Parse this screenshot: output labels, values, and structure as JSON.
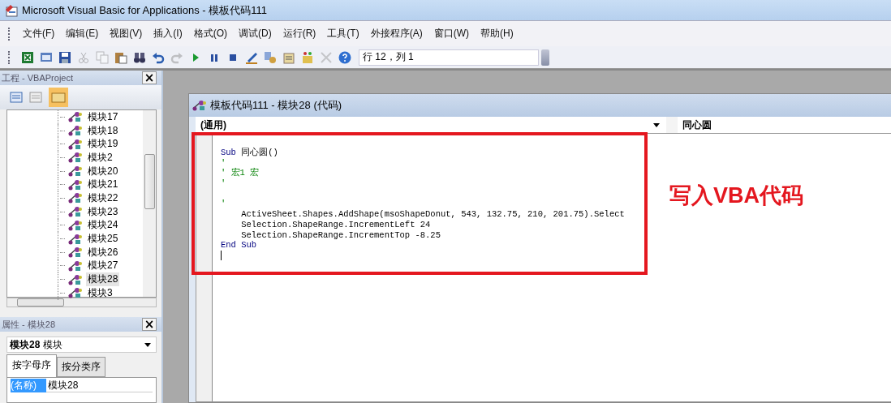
{
  "window": {
    "title": "Microsoft Visual Basic for Applications - 模板代码111"
  },
  "menu": [
    "文件(F)",
    "编辑(E)",
    "视图(V)",
    "插入(I)",
    "格式(O)",
    "调试(D)",
    "运行(R)",
    "工具(T)",
    "外接程序(A)",
    "窗口(W)",
    "帮助(H)"
  ],
  "toolbar": {
    "buttons": [
      {
        "kind": "excel",
        "disabled": false
      },
      {
        "kind": "form",
        "disabled": false
      },
      {
        "kind": "save",
        "disabled": false
      },
      {
        "kind": "cut",
        "disabled": true
      },
      {
        "kind": "copy",
        "disabled": true
      },
      {
        "kind": "paste",
        "disabled": false
      },
      {
        "kind": "find",
        "disabled": false
      },
      {
        "kind": "undo",
        "disabled": false
      },
      {
        "kind": "redo",
        "disabled": true
      },
      {
        "kind": "run",
        "disabled": false
      },
      {
        "kind": "pause",
        "disabled": false
      },
      {
        "kind": "stop",
        "disabled": false
      },
      {
        "kind": "design",
        "disabled": false
      },
      {
        "kind": "explorer",
        "disabled": false
      },
      {
        "kind": "properties",
        "disabled": false
      },
      {
        "kind": "browser",
        "disabled": false
      },
      {
        "kind": "toolbox",
        "disabled": true
      },
      {
        "kind": "help",
        "disabled": false
      }
    ],
    "position": "行 12，列 1"
  },
  "project_pane": {
    "title": "工程 - VBAProject",
    "close": "×",
    "items": [
      {
        "name": "模块17",
        "selected": false
      },
      {
        "name": "模块18",
        "selected": false
      },
      {
        "name": "模块19",
        "selected": false
      },
      {
        "name": "模块2",
        "selected": false
      },
      {
        "name": "模块20",
        "selected": false
      },
      {
        "name": "模块21",
        "selected": false
      },
      {
        "name": "模块22",
        "selected": false
      },
      {
        "name": "模块23",
        "selected": false
      },
      {
        "name": "模块24",
        "selected": false
      },
      {
        "name": "模块25",
        "selected": false
      },
      {
        "name": "模块26",
        "selected": false
      },
      {
        "name": "模块27",
        "selected": false
      },
      {
        "name": "模块28",
        "selected": true
      },
      {
        "name": "模块3",
        "selected": false
      }
    ]
  },
  "properties_pane": {
    "title": "属性 - 模块28",
    "close": "×",
    "object_name": "模块28",
    "object_type": "模块",
    "tabs": [
      {
        "label": "按字母序",
        "selected": true
      },
      {
        "label": "按分类序",
        "selected": false
      }
    ],
    "rows": [
      {
        "name": "(名称)",
        "value": "模块28",
        "selected": true
      }
    ]
  },
  "code_window": {
    "title": "模板代码111 - 模块28 (代码)",
    "object_combo": "(通用)",
    "procedure_combo": "同心圆",
    "lines": [
      {
        "kind": "code",
        "segments": [
          {
            "kind": "keyword",
            "text": "Sub"
          },
          {
            "kind": "plain",
            "text": " 同心圆()"
          }
        ]
      },
      {
        "kind": "code",
        "segments": [
          {
            "kind": "comment",
            "text": "'"
          }
        ]
      },
      {
        "kind": "code",
        "segments": [
          {
            "kind": "comment",
            "text": "' 宏1 宏"
          }
        ]
      },
      {
        "kind": "code",
        "segments": [
          {
            "kind": "comment",
            "text": "'"
          }
        ]
      },
      {
        "kind": "blank"
      },
      {
        "kind": "code",
        "segments": [
          {
            "kind": "comment",
            "text": "'"
          }
        ]
      },
      {
        "kind": "code",
        "segments": [
          {
            "kind": "plain",
            "text": "    ActiveSheet.Shapes.AddShape(msoShapeDonut, 543, 132.75, 210, 201.75).Select"
          }
        ]
      },
      {
        "kind": "code",
        "segments": [
          {
            "kind": "plain",
            "text": "    Selection.ShapeRange.IncrementLeft 24"
          }
        ]
      },
      {
        "kind": "code",
        "segments": [
          {
            "kind": "plain",
            "text": "    Selection.ShapeRange.IncrementTop -8.25"
          }
        ]
      },
      {
        "kind": "code",
        "segments": [
          {
            "kind": "keyword",
            "text": "End Sub"
          }
        ]
      }
    ]
  },
  "annotation": "写入VBA代码"
}
